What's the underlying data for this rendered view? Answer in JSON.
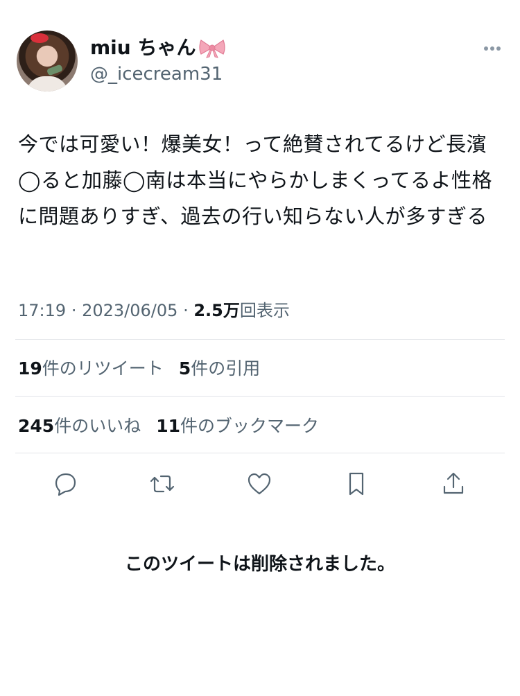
{
  "author": {
    "display_name": "miu ちゃん",
    "handle": "@_icecream31"
  },
  "tweet": {
    "text": "今では可愛い！爆美女！って絶賛されてるけど長濱◯ると加藤◯南は本当にやらかしまくってるよ性格に問題ありすぎ、過去の行い知らない人が多すぎる",
    "time": "17:19",
    "sep": "·",
    "date": "2023/06/05",
    "views_num": "2.5万",
    "views_label": "回表示"
  },
  "stats": {
    "retweets_num": "19",
    "retweets_label": "件のリツイート",
    "quotes_num": "5",
    "quotes_label": "件の引用",
    "likes_num": "245",
    "likes_label": "件のいいね",
    "bookmarks_num": "11",
    "bookmarks_label": "件のブックマーク"
  },
  "icons": [
    "more-icon",
    "reply-icon",
    "retweet-icon",
    "like-icon",
    "bookmark-icon",
    "share-icon",
    "ribbon-emoji-icon"
  ],
  "deleted_notice": "このツイートは削除されました。",
  "colors": {
    "text": "#0f1419",
    "secondary": "#536471",
    "divider": "#e1e4e8"
  }
}
